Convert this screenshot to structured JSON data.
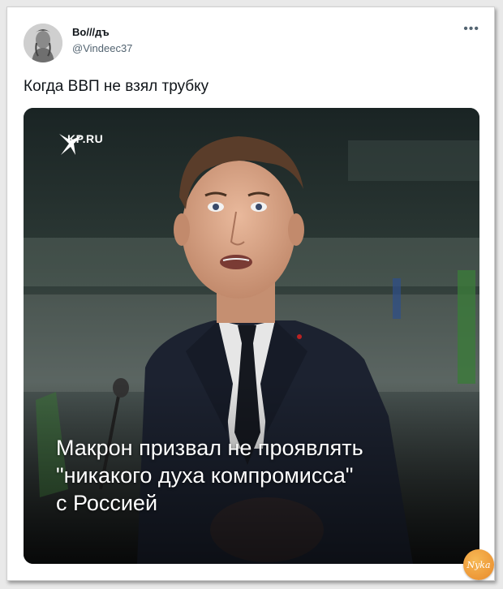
{
  "tweet": {
    "display_name": "Во///дъ",
    "handle": "@Vindeec37",
    "more_icon": "more-horizontal-icon",
    "text": "Когда ВВП не взял трубку"
  },
  "media": {
    "brand": "KP.RU",
    "brand_icon": "bird-logo-icon",
    "headline_lines": [
      "Макрон призвал не проявлять",
      "\"никакого духа компромисса\"",
      "с Россией"
    ]
  },
  "watermark": {
    "text": "Nyka"
  },
  "colors": {
    "text_primary": "#0f1419",
    "text_secondary": "#536471",
    "watermark": "#e8892a"
  }
}
